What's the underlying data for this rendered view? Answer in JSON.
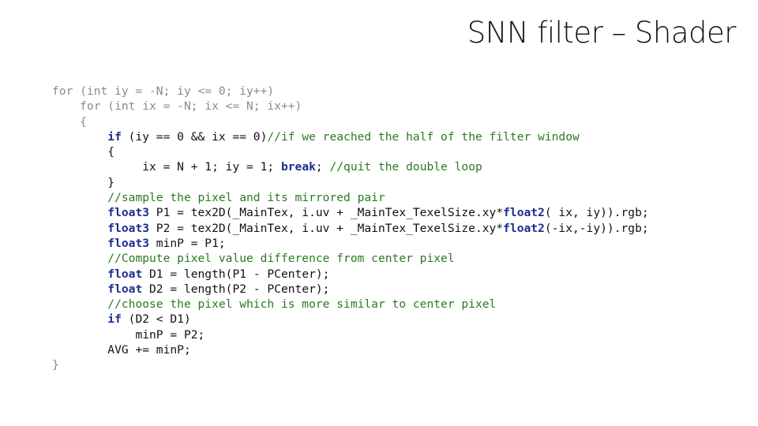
{
  "slide": {
    "title": "SNN filter – Shader"
  },
  "code": {
    "lines": [
      {
        "indent": 0,
        "faded": true,
        "tokens": [
          {
            "t": "kw",
            "v": "for"
          },
          {
            "t": "pl",
            "v": " (int iy = -N; iy <= 0; iy++)"
          }
        ]
      },
      {
        "indent": 4,
        "faded": true,
        "tokens": [
          {
            "t": "kw",
            "v": "for"
          },
          {
            "t": "pl",
            "v": " (int ix = -N; ix <= N; ix++)"
          }
        ]
      },
      {
        "indent": 4,
        "faded": true,
        "tokens": [
          {
            "t": "pl",
            "v": "{"
          }
        ]
      },
      {
        "indent": 8,
        "faded": false,
        "tokens": [
          {
            "t": "kw",
            "v": "if"
          },
          {
            "t": "pl",
            "v": " (iy == 0 && ix == 0)"
          },
          {
            "t": "cm",
            "v": "//if we reached the half of the filter window"
          }
        ]
      },
      {
        "indent": 8,
        "faded": false,
        "tokens": [
          {
            "t": "pl",
            "v": "{"
          }
        ]
      },
      {
        "indent": 13,
        "faded": false,
        "tokens": [
          {
            "t": "pl",
            "v": "ix = N + 1; iy = 1; "
          },
          {
            "t": "kw",
            "v": "break"
          },
          {
            "t": "pl",
            "v": "; "
          },
          {
            "t": "cm",
            "v": "//quit the double loop"
          }
        ]
      },
      {
        "indent": 8,
        "faded": false,
        "tokens": [
          {
            "t": "pl",
            "v": "}"
          }
        ]
      },
      {
        "indent": 8,
        "faded": false,
        "tokens": [
          {
            "t": "cm",
            "v": "//sample the pixel and its mirrored pair"
          }
        ]
      },
      {
        "indent": 8,
        "faded": false,
        "tokens": [
          {
            "t": "type",
            "v": "float3"
          },
          {
            "t": "pl",
            "v": " P1 = tex2D(_MainTex, i.uv + _MainTex_TexelSize.xy*"
          },
          {
            "t": "type",
            "v": "float2"
          },
          {
            "t": "pl",
            "v": "( ix, iy)).rgb;"
          }
        ]
      },
      {
        "indent": 8,
        "faded": false,
        "tokens": [
          {
            "t": "type",
            "v": "float3"
          },
          {
            "t": "pl",
            "v": " P2 = tex2D(_MainTex, i.uv + _MainTex_TexelSize.xy*"
          },
          {
            "t": "type",
            "v": "float2"
          },
          {
            "t": "pl",
            "v": "(-ix,-iy)).rgb;"
          }
        ]
      },
      {
        "indent": 8,
        "faded": false,
        "tokens": [
          {
            "t": "type",
            "v": "float3"
          },
          {
            "t": "pl",
            "v": " minP = P1;"
          }
        ]
      },
      {
        "indent": 8,
        "faded": false,
        "tokens": [
          {
            "t": "cm",
            "v": "//Compute pixel value difference from center pixel"
          }
        ]
      },
      {
        "indent": 8,
        "faded": false,
        "tokens": [
          {
            "t": "type",
            "v": "float"
          },
          {
            "t": "pl",
            "v": " D1 = length(P1 - PCenter);"
          }
        ]
      },
      {
        "indent": 8,
        "faded": false,
        "tokens": [
          {
            "t": "type",
            "v": "float"
          },
          {
            "t": "pl",
            "v": " D2 = length(P2 - PCenter);"
          }
        ]
      },
      {
        "indent": 8,
        "faded": false,
        "tokens": [
          {
            "t": "cm",
            "v": "//choose the pixel which is more similar to center pixel"
          }
        ]
      },
      {
        "indent": 8,
        "faded": false,
        "tokens": [
          {
            "t": "kw",
            "v": "if"
          },
          {
            "t": "pl",
            "v": " (D2 < D1)"
          }
        ]
      },
      {
        "indent": 12,
        "faded": false,
        "tokens": [
          {
            "t": "pl",
            "v": "minP = P2;"
          }
        ]
      },
      {
        "indent": 8,
        "faded": false,
        "tokens": [
          {
            "t": "pl",
            "v": "AVG += minP;"
          }
        ]
      },
      {
        "indent": 0,
        "faded": true,
        "tokens": [
          {
            "t": "pl",
            "v": "}"
          }
        ]
      }
    ]
  },
  "colors": {
    "keyword": "#1b2d8f",
    "comment": "#2a7a21",
    "plain": "#111111",
    "faded": "#8a8a8a"
  }
}
